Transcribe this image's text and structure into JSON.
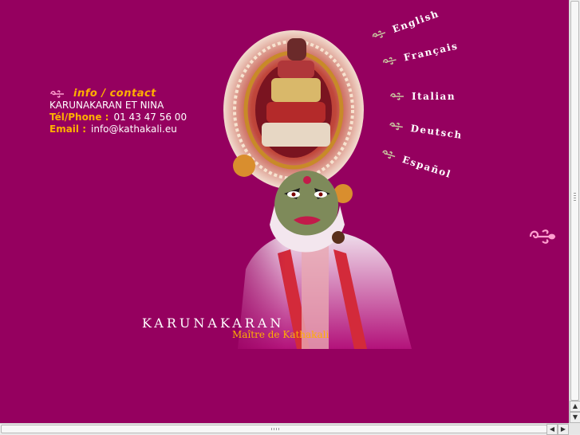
{
  "contact": {
    "heading": "info / contact",
    "names": "KARUNAKARAN ET NINA",
    "phone_label": "Tél/Phone :",
    "phone_value": "01 43 47 56 00",
    "email_label": "Email :",
    "email_value": "info@kathakali.eu"
  },
  "artist": {
    "name": "KARUNAKARAN",
    "title": "Maître de Kathakali"
  },
  "languages": [
    "English",
    "Français",
    "Italian",
    "Deutsch",
    "Español"
  ],
  "colors": {
    "background": "#95005f",
    "accent": "#ffb000",
    "icon_pink": "#ff9fcf"
  },
  "icons": {
    "bullet": "swirl-ornament-icon",
    "nav": "swirl-ornament-icon"
  }
}
